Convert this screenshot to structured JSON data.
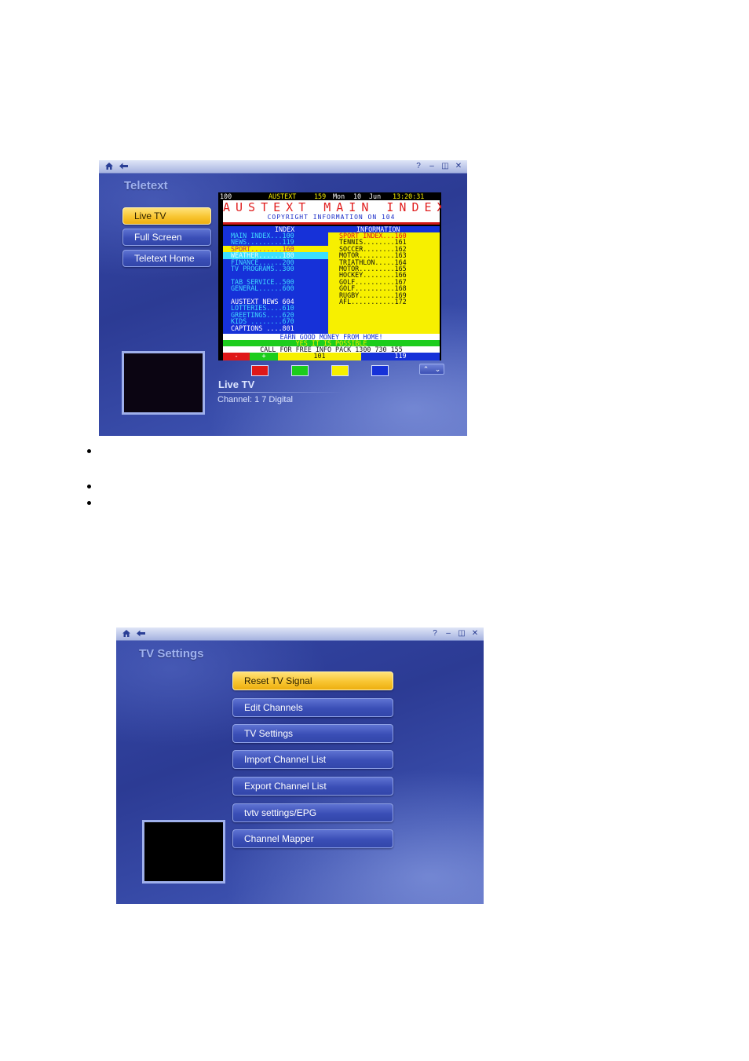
{
  "teletext_window": {
    "title": "Teletext",
    "menu": [
      {
        "label": "Live TV",
        "active": true
      },
      {
        "label": "Full Screen",
        "active": false
      },
      {
        "label": "Teletext Home",
        "active": false
      }
    ],
    "teletext": {
      "header": {
        "page": "100",
        "service": "AUSTEXT",
        "sub_page": "159",
        "day": "Mon",
        "date": "10",
        "month": "Jun",
        "time": "13:20:31"
      },
      "banner_title": "AUSTEXT MAIN INDEX",
      "banner_sub": "COPYRIGHT INFORMATION ON 104",
      "col_left": "INDEX",
      "col_right": "INFORMATION",
      "left_items": [
        "MAIN INDEX...100",
        "NEWS.........119",
        "SPORT........160",
        "WEATHER......180",
        "FINANCE......200",
        "TV PROGRAMS..300",
        "",
        "TAB SERVICE..500",
        "GENERAL......600",
        "",
        "AUSTEXT NEWS 604",
        "LOTTERIES....610",
        "GREETINGS....620",
        "KIDS ........670",
        "CAPTIONS ....801"
      ],
      "right_items": [
        "SPORT INDEX...160",
        "TENNIS........161",
        "SOCCER........162",
        "MOTOR.........163",
        "TRIATHLON.....164",
        "MOTOR.........165",
        "HOCKEY........166",
        "GOLF..........167",
        "GOLF..........168",
        "RUGBY.........169",
        "AFL...........172"
      ],
      "strip_1": "EARN GOOD MONEY FROM HOME!",
      "strip_2": "YES IT IS POSSIBLE",
      "strip_3": "CALL FOR FREE INFO PACK 1300 730 155",
      "fastext": [
        {
          "label": "-",
          "color": "#e01818"
        },
        {
          "label": "+",
          "color": "#1ccd1c"
        },
        {
          "label": "101",
          "color": "#f7f000"
        },
        {
          "label": "119",
          "color": "#1631d8"
        }
      ]
    },
    "color_keys": [
      "#e01818",
      "#1ccd1c",
      "#f7f000",
      "#1631d8"
    ],
    "info": {
      "title": "Live TV",
      "channel": "Channel: 1 7 Digital"
    }
  },
  "bullets": 3,
  "tv_settings_window": {
    "title": "TV Settings",
    "menu": [
      {
        "label": "Reset TV Signal",
        "active": true
      },
      {
        "label": "Edit Channels",
        "active": false
      },
      {
        "label": "TV Settings",
        "active": false
      },
      {
        "label": "Import Channel List",
        "active": false
      },
      {
        "label": "Export Channel List",
        "active": false
      },
      {
        "label": "tvtv settings/EPG",
        "active": false
      },
      {
        "label": "Channel Mapper",
        "active": false
      }
    ]
  },
  "icons": {
    "home": "home-icon",
    "back": "back-arrow-icon",
    "help": "help-icon",
    "minimize": "minimize-icon",
    "restore": "restore-icon",
    "close": "close-icon"
  },
  "colors": {
    "accent_yellow": "#f8c531",
    "window_blue": "#2c3b94"
  }
}
